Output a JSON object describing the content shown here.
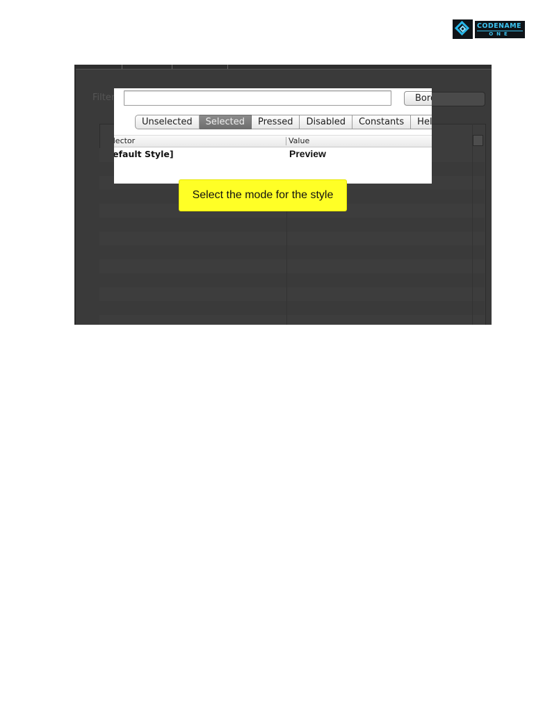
{
  "logo": {
    "word_top": "CODENAME",
    "word_bottom": "ONE"
  },
  "editor": {
    "filter_label": "Filter",
    "filter_value": "",
    "border_wizard_label": "Border Wizard",
    "tabs": [
      {
        "label": "Unselected",
        "active": false
      },
      {
        "label": "Selected",
        "active": true
      },
      {
        "label": "Pressed",
        "active": false
      },
      {
        "label": "Disabled",
        "active": false
      },
      {
        "label": "Constants",
        "active": false
      },
      {
        "label": "Help",
        "active": false
      }
    ],
    "table": {
      "columns": [
        "Selector",
        "Value"
      ],
      "rows": [
        {
          "selector": "[Default Style]",
          "value": "Preview"
        }
      ]
    }
  },
  "callout": {
    "text": "Select the mode for the style"
  },
  "colors": {
    "callout_bg": "#ffff26",
    "active_tab": "#7d7d7d",
    "panel_bg": "#3a3a3a"
  }
}
